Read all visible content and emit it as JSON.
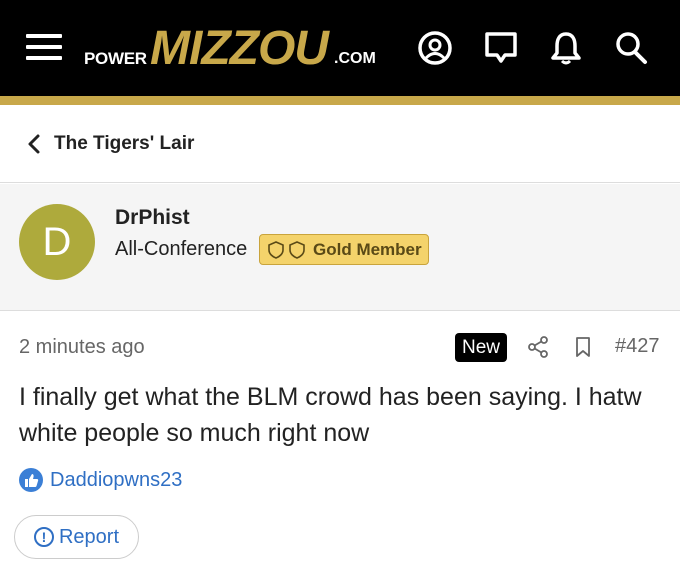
{
  "header": {
    "logo_prefix": "POWER",
    "logo_main": "MIZZOU",
    "logo_suffix": ".COM",
    "icons": [
      "menu-icon",
      "account-icon",
      "chat-icon",
      "alert-bell-icon",
      "search-icon"
    ]
  },
  "breadcrumb": {
    "label": "The Tigers' Lair",
    "icon": "chevron-left-icon"
  },
  "author": {
    "avatar_letter": "D",
    "username": "DrPhist",
    "title": "All-Conference",
    "badge_label": "Gold Member"
  },
  "post": {
    "timestamp": "2 minutes ago",
    "status_badge": "New",
    "number": "#427",
    "body": "I finally get what the BLM crowd has been saying. I hatw white people so much right now",
    "reaction_user": "Daddiopwns23",
    "report_label": "Report"
  },
  "colors": {
    "header_bg": "#000000",
    "brand_gold": "#c8a84a",
    "avatar_bg": "#aeaa3c",
    "badge_bg": "#f4d36b",
    "link_blue": "#2f6fc4"
  }
}
